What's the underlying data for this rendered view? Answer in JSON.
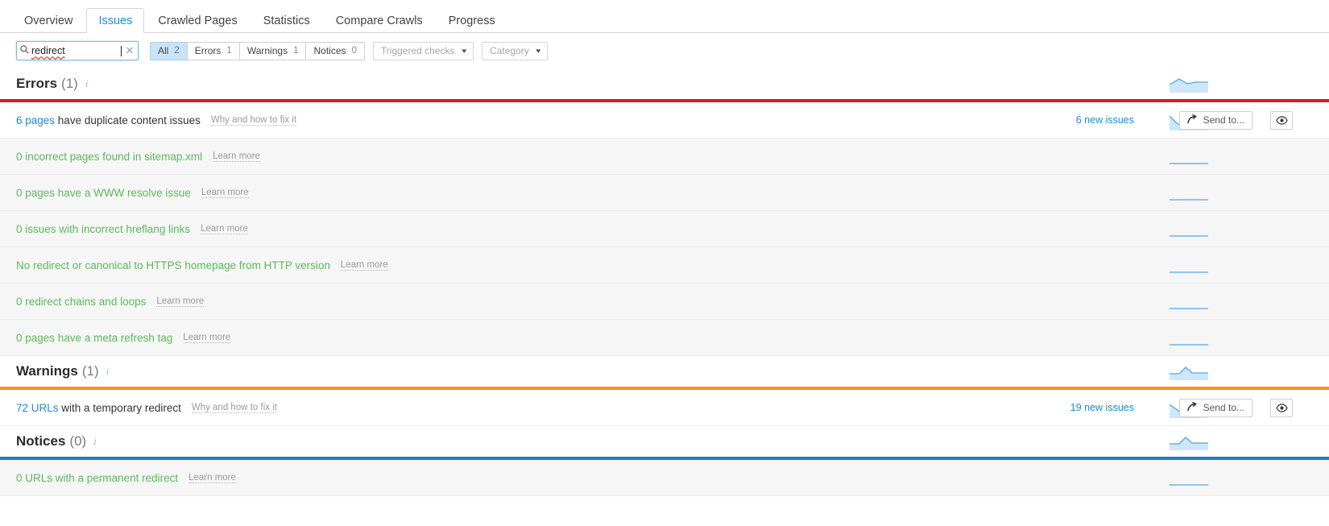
{
  "tabs": [
    {
      "label": "Overview",
      "active": false
    },
    {
      "label": "Issues",
      "active": true
    },
    {
      "label": "Crawled Pages",
      "active": false
    },
    {
      "label": "Statistics",
      "active": false
    },
    {
      "label": "Compare Crawls",
      "active": false
    },
    {
      "label": "Progress",
      "active": false
    }
  ],
  "filters": {
    "search": {
      "value": "redirect",
      "placeholder": "Search",
      "icon": "search-icon",
      "clear_icon": "clear-icon"
    },
    "segments": [
      {
        "label": "All",
        "count": "2",
        "active": true
      },
      {
        "label": "Errors",
        "count": "1",
        "active": false
      },
      {
        "label": "Warnings",
        "count": "1",
        "active": false
      },
      {
        "label": "Notices",
        "count": "0",
        "active": false
      }
    ],
    "dropdowns": [
      {
        "label": "Triggered checks"
      },
      {
        "label": "Category"
      }
    ]
  },
  "colors": {
    "errors": "#d81a1a",
    "warnings": "#f7941e",
    "notices": "#1a7fc1",
    "green": "#5cb85c",
    "link": "#1a8cd8"
  },
  "sections": [
    {
      "title": "Errors",
      "count": "(1)",
      "rule_color": "#d81a1a",
      "rows": [
        {
          "count_text": "6 pages",
          "text": " have duplicate content issues",
          "fix_label": "Why and how to fix it",
          "new_issues": "6 new issues",
          "zero": false,
          "spark": "wave-down",
          "send_label": "Send to...",
          "has_actions": true
        },
        {
          "text": "0 incorrect pages found in sitemap.xml",
          "fix_label": "Learn more",
          "zero": true,
          "spark": "flat",
          "has_actions": false
        },
        {
          "text": "0 pages have a WWW resolve issue",
          "fix_label": "Learn more",
          "zero": true,
          "spark": "flat",
          "has_actions": false
        },
        {
          "text": "0 issues with incorrect hreflang links",
          "fix_label": "Learn more",
          "zero": true,
          "spark": "flat",
          "has_actions": false
        },
        {
          "text": "No redirect or canonical to HTTPS homepage from HTTP version",
          "fix_label": "Learn more",
          "zero": true,
          "spark": "flat",
          "has_actions": false
        },
        {
          "text": "0 redirect chains and loops",
          "fix_label": "Learn more",
          "zero": true,
          "spark": "flat",
          "has_actions": false
        },
        {
          "text": "0 pages have a meta refresh tag",
          "fix_label": "Learn more",
          "zero": true,
          "spark": "flat",
          "has_actions": false
        }
      ]
    },
    {
      "title": "Warnings",
      "count": "(1)",
      "rule_color": "#f7941e",
      "rows": [
        {
          "count_text": "72 URLs",
          "text": " with a temporary redirect",
          "fix_label": "Why and how to fix it",
          "new_issues": "19 new issues",
          "zero": false,
          "spark": "wave-dip",
          "send_label": "Send to...",
          "has_actions": true
        }
      ]
    },
    {
      "title": "Notices",
      "count": "(0)",
      "rule_color": "#1a7fc1",
      "rows": [
        {
          "text": "0 URLs with a permanent redirect",
          "fix_label": "Learn more",
          "zero": true,
          "spark": "flat",
          "has_actions": false
        }
      ]
    }
  ],
  "icons": {
    "info": "i",
    "search": "search-icon",
    "clear": "✕",
    "chevron": "▾",
    "share": "↗",
    "eye": "eye-icon"
  }
}
